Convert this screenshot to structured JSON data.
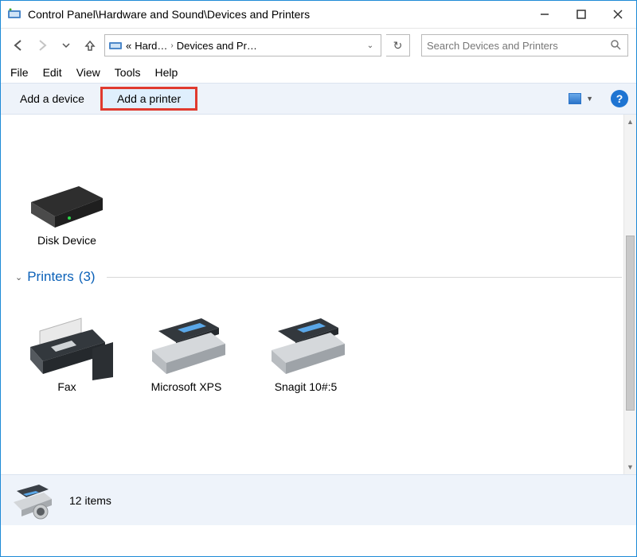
{
  "window": {
    "title": "Control Panel\\Hardware and Sound\\Devices and Printers"
  },
  "breadcrumb": {
    "prefix": "«",
    "seg1": "Hard…",
    "seg2": "Devices and Pr…"
  },
  "search": {
    "placeholder": "Search Devices and Printers"
  },
  "menus": {
    "file": "File",
    "edit": "Edit",
    "view": "View",
    "tools": "Tools",
    "help": "Help"
  },
  "toolbar": {
    "add_device": "Add a device",
    "add_printer": "Add a printer"
  },
  "devices": {
    "disk": "Disk Device"
  },
  "printers_group": {
    "label": "Printers",
    "count": "(3)"
  },
  "printers": {
    "p1": "Fax",
    "p2": "Microsoft XPS",
    "p3": "Snagit 10#:5"
  },
  "status": {
    "items": "12 items"
  }
}
